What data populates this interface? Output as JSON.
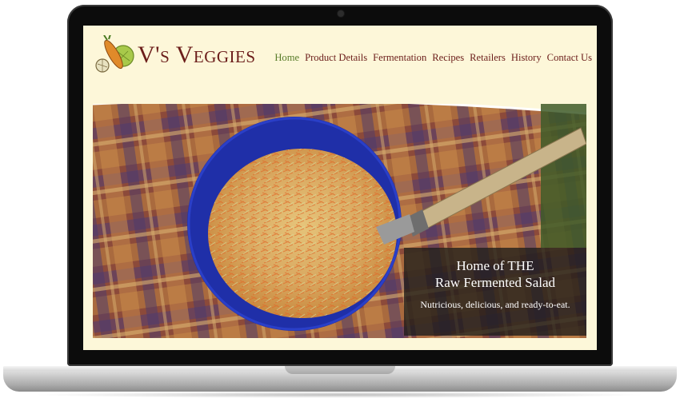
{
  "site": {
    "brand": "V's Veggies",
    "logo_icon": "vegetables-logo-icon"
  },
  "nav": {
    "items": [
      {
        "label": "Home",
        "active": true
      },
      {
        "label": "Product Details",
        "active": false
      },
      {
        "label": "Fermentation",
        "active": false
      },
      {
        "label": "Recipes",
        "active": false
      },
      {
        "label": "Retailers",
        "active": false
      },
      {
        "label": "History",
        "active": false
      },
      {
        "label": "Contact Us",
        "active": false
      }
    ]
  },
  "hero": {
    "heading_line1": "Home of THE",
    "heading_line2": "Raw Fermented Salad",
    "tagline": "Nutricious, delicious, and ready-to-eat."
  },
  "colors": {
    "page_background": "#fdf7d9",
    "brand_text": "#6b1d1a",
    "nav_active": "#5a7d2a",
    "bowl": "#1f2fa8"
  }
}
